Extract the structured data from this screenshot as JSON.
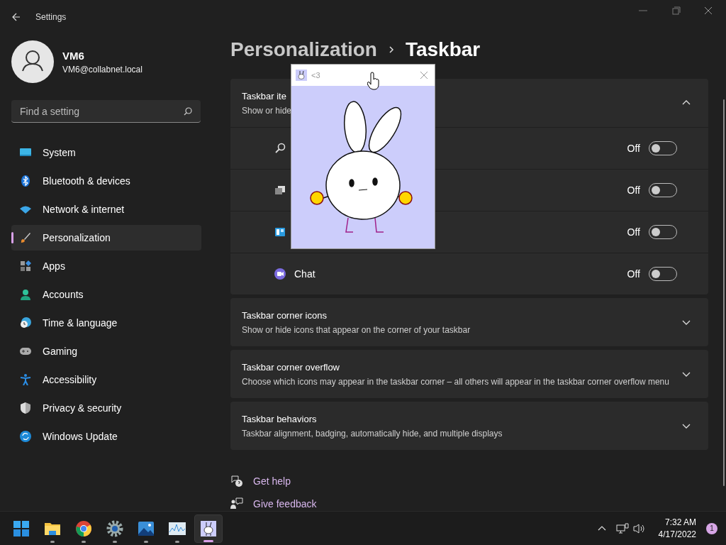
{
  "window": {
    "title": "Settings"
  },
  "account": {
    "name": "VM6",
    "email": "VM6@collabnet.local"
  },
  "search": {
    "placeholder": "Find a setting"
  },
  "nav": [
    {
      "label": "System",
      "kind": "system",
      "selected": false
    },
    {
      "label": "Bluetooth & devices",
      "kind": "bluetooth",
      "selected": false
    },
    {
      "label": "Network & internet",
      "kind": "network",
      "selected": false
    },
    {
      "label": "Personalization",
      "kind": "brush",
      "selected": true
    },
    {
      "label": "Apps",
      "kind": "apps",
      "selected": false
    },
    {
      "label": "Accounts",
      "kind": "accounts",
      "selected": false
    },
    {
      "label": "Time & language",
      "kind": "time",
      "selected": false
    },
    {
      "label": "Gaming",
      "kind": "gaming",
      "selected": false
    },
    {
      "label": "Accessibility",
      "kind": "accessibility",
      "selected": false
    },
    {
      "label": "Privacy & security",
      "kind": "privacy",
      "selected": false
    },
    {
      "label": "Windows Update",
      "kind": "update",
      "selected": false
    }
  ],
  "breadcrumb": {
    "parent": "Personalization",
    "current": "Taskbar"
  },
  "sections": [
    {
      "title": "Taskbar ite",
      "subtitle": "Show or hide",
      "expanded": true,
      "items": [
        {
          "kind": "search",
          "state": "Off",
          "on": false
        },
        {
          "kind": "taskview",
          "state": "Off",
          "on": false
        },
        {
          "kind": "widgets",
          "state": "Off",
          "on": false
        },
        {
          "kind": "chat",
          "label": "Chat",
          "state": "Off",
          "on": false
        }
      ]
    },
    {
      "title": "Taskbar corner icons",
      "subtitle": "Show or hide icons that appear on the corner of your taskbar",
      "expanded": false
    },
    {
      "title": "Taskbar corner overflow",
      "subtitle": "Choose which icons may appear in the taskbar corner – all others will appear in the taskbar corner overflow menu",
      "expanded": false
    },
    {
      "title": "Taskbar behaviors",
      "subtitle": "Taskbar alignment, badging, automatically hide, and multiple displays",
      "expanded": false
    }
  ],
  "links": [
    {
      "kind": "help",
      "label": "Get help"
    },
    {
      "kind": "feedback",
      "label": "Give feedback"
    }
  ],
  "popup": {
    "title": "<3"
  },
  "taskbar": {
    "apps": [
      {
        "kind": "start",
        "running": false,
        "selected": false
      },
      {
        "kind": "explorer",
        "running": true,
        "selected": false
      },
      {
        "kind": "chrome",
        "running": true,
        "selected": false
      },
      {
        "kind": "settings",
        "running": true,
        "selected": false
      },
      {
        "kind": "photos",
        "running": true,
        "selected": false
      },
      {
        "kind": "monitor",
        "running": true,
        "selected": false
      },
      {
        "kind": "bunny",
        "running": true,
        "selected": true
      }
    ],
    "time": "7:32 AM",
    "date": "4/17/2022",
    "notifications": "1"
  }
}
